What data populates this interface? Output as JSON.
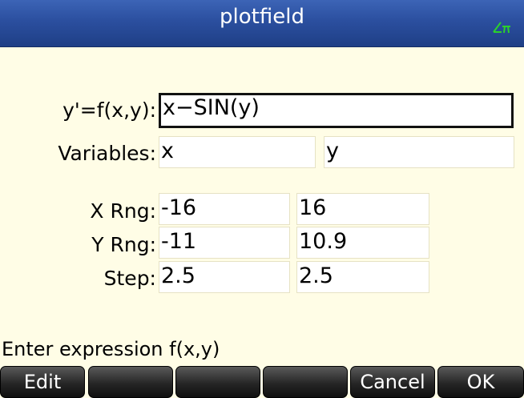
{
  "title": "plotfield",
  "colors": {
    "title_bar": "#2b4f9f",
    "angle_indicator": "#2bd12b",
    "background": "#fffde6"
  },
  "form": {
    "expr_label": "y'=f(x,y):",
    "expr_value": "x−SIN(y)",
    "variables_label": "Variables:",
    "var_x": "x",
    "var_y": "y",
    "xrng_label": "X Rng:",
    "xrng_min": "-16",
    "xrng_max": "16",
    "yrng_label": "Y Rng:",
    "yrng_min": "-11",
    "yrng_max": "10.9",
    "step_label": "Step:",
    "step_x": "2.5",
    "step_y": "2.5"
  },
  "help_text": "Enter expression f(x,y)",
  "softkeys": [
    "Edit",
    "",
    "",
    "",
    "Cancel",
    "OK"
  ],
  "icons": {
    "status": "angle-radians-icon"
  }
}
